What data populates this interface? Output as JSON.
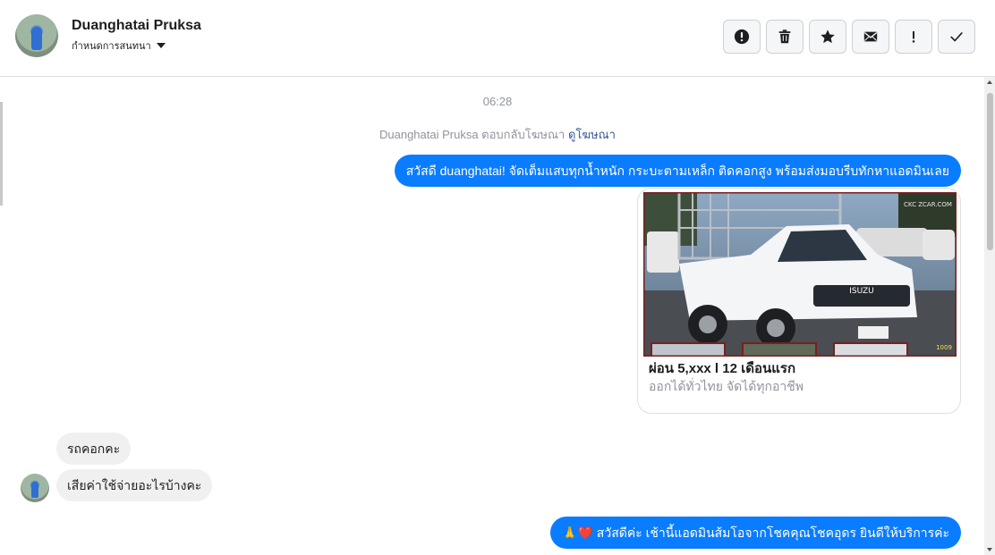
{
  "header": {
    "name": "Duanghatai Pruksa",
    "subtitle": "กำหนดการสนทนา",
    "tools": [
      {
        "icon": "alert-circle-icon",
        "name": "spam-button"
      },
      {
        "icon": "trash-icon",
        "name": "delete-button"
      },
      {
        "icon": "star-icon",
        "name": "star-button"
      },
      {
        "icon": "envelope-icon",
        "name": "mark-unread-button"
      },
      {
        "icon": "exclamation-icon",
        "name": "follow-up-button"
      },
      {
        "icon": "check-icon",
        "name": "done-button"
      }
    ]
  },
  "chat": {
    "timestamp": "06:28",
    "ad_reply_text": "Duanghatai Pruksa ตอบกลับโฆษณา",
    "ad_reply_link": "ดูโฆษณา",
    "messages": [
      {
        "from": "page",
        "text": "สวัสดี duanghatai! จัดเต็มแสบทุกน้ำหนัก กระบะตามเหล็ก ติดคอกสูง พร้อมส่งมอบรีบทักหาแอดมินเลย"
      },
      {
        "from": "user",
        "text": "รถคอกคะ"
      },
      {
        "from": "user",
        "text": "เสียค่าใช้จ่ายอะไรบ้างคะ"
      },
      {
        "from": "page",
        "emoji": "🙏❤️",
        "text": "สวัสดีค่ะ เช้านี้แอดมินส้มโอจากโชคคุณโชคอุดร ยินดีให้บริการค่ะ"
      }
    ],
    "ad_card": {
      "title": "ผ่อน 5,xxx l 12 เดือนแรก",
      "description": "ออกได้ทั่วไทย จัดได้ทุกอาชีพ",
      "image_watermark": "CKC ZCAR.COM",
      "image_badge": "1009",
      "truck_brand": "ISUZU"
    }
  },
  "colors": {
    "outgoing_bubble": "#0a7cff",
    "incoming_bubble": "#f1f0f0",
    "link": "#385898",
    "muted_text": "#90949c"
  }
}
